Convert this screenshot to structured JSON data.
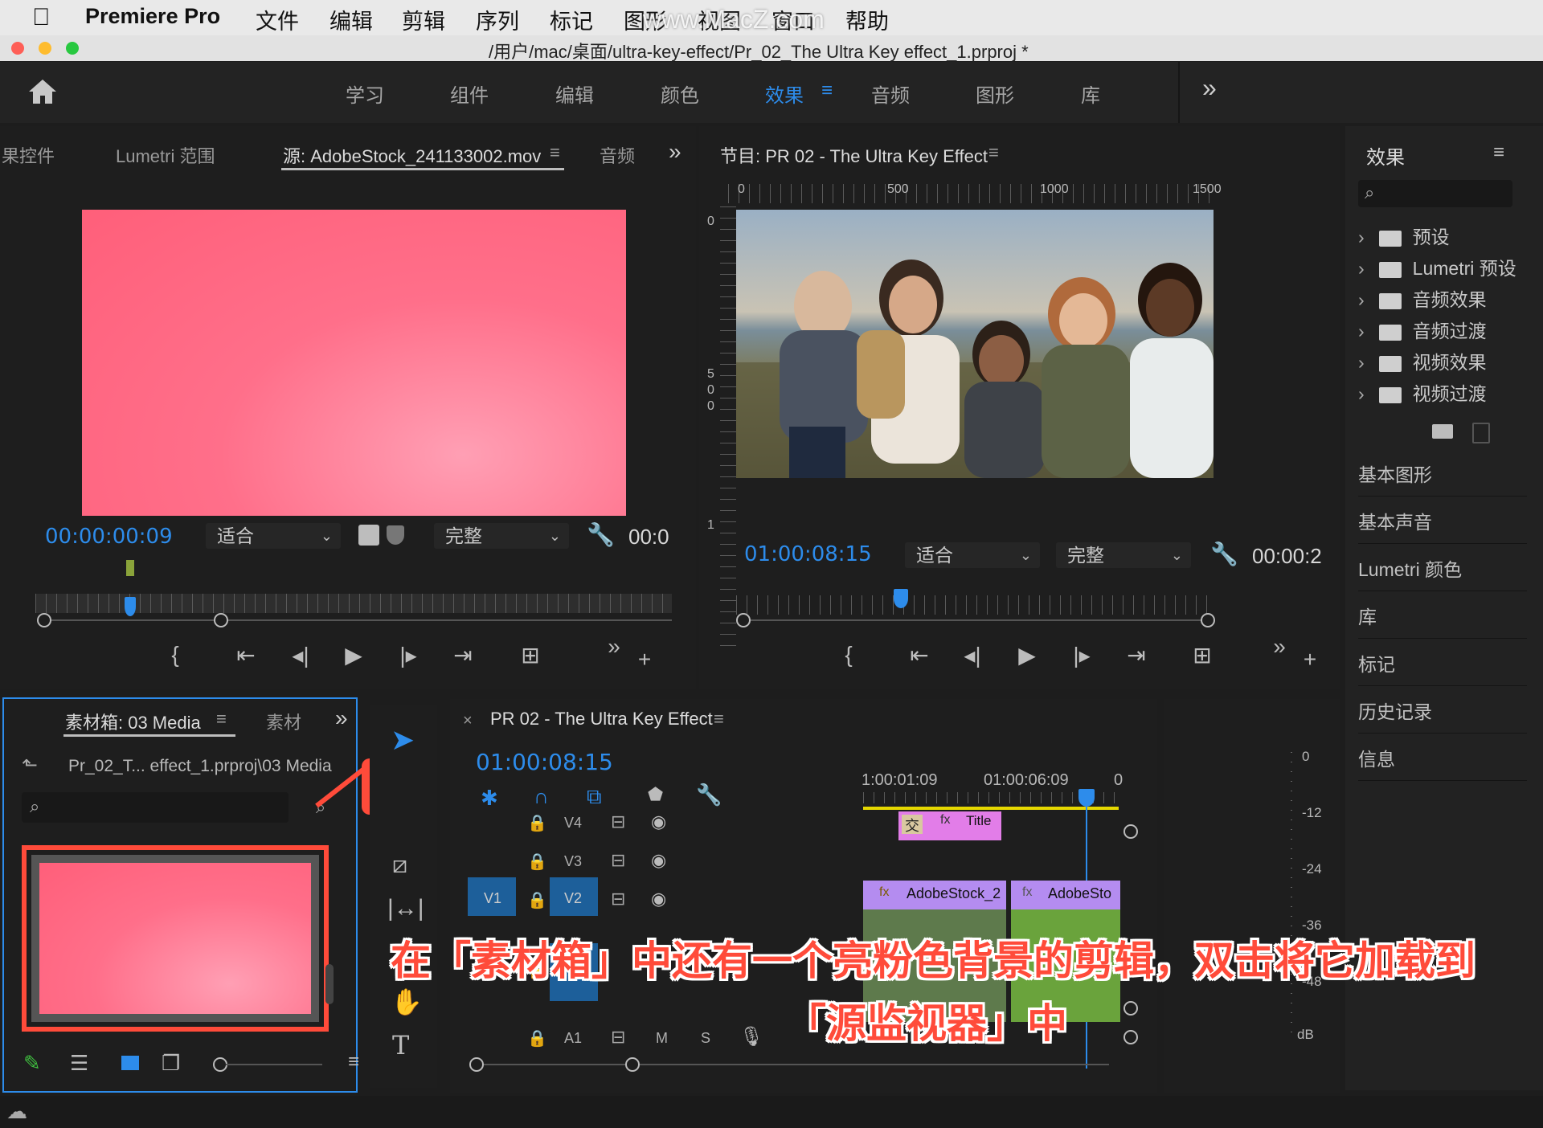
{
  "menubar": {
    "app": "Premiere Pro",
    "items": [
      "文件",
      "编辑",
      "剪辑",
      "序列",
      "标记",
      "图形",
      "视图",
      "窗口",
      "帮助"
    ],
    "watermark": "www.MacZ.com"
  },
  "titlebar": {
    "path": "/用户/mac/桌面/ultra-key-effect/Pr_02_The Ultra Key effect_1.prproj *"
  },
  "workspaces": {
    "tabs": [
      "学习",
      "组件",
      "编辑",
      "颜色",
      "效果",
      "音频",
      "图形",
      "库"
    ],
    "active": "效果",
    "menu_glyph": "≡",
    "overflow": "»"
  },
  "source_monitor": {
    "tabs": [
      "果控件",
      "Lumetri 范围",
      "源: AdobeStock_241133002.mov",
      "音频"
    ],
    "active_tab": "源: AdobeStock_241133002.mov",
    "timecode": "00:00:00:09",
    "fit": "适合",
    "quality": "完整",
    "end_timecode": "00:0",
    "playhead_fraction": 0.14
  },
  "program_monitor": {
    "title": "节目: PR 02 - The Ultra Key Effect",
    "ruler_labels": [
      "0",
      "500",
      "1000",
      "1500"
    ],
    "vruler_labels": [
      "0",
      "5",
      "0",
      "0",
      "1"
    ],
    "timecode": "01:00:08:15",
    "fit": "适合",
    "quality": "完整",
    "end_timecode": "00:00:2",
    "playhead_fraction": 0.33
  },
  "effects_panel": {
    "title": "效果",
    "search_placeholder": "",
    "items": [
      "预设",
      "Lumetri 预设",
      "音频效果",
      "音频过渡",
      "视频效果",
      "视频过渡"
    ]
  },
  "side_panels": [
    "基本图形",
    "基本声音",
    "Lumetri 颜色",
    "库",
    "标记",
    "历史记录",
    "信息"
  ],
  "project": {
    "tabs": [
      "素材箱: 03 Media",
      "素材"
    ],
    "path": "Pr_02_T... effect_1.prproj\\03 Media",
    "callout": "双击"
  },
  "timeline": {
    "title": "PR 02 - The Ultra Key Effect",
    "timecode": "01:00:08:15",
    "ruler_labels": [
      "1:00:01:09",
      "01:00:06:09",
      "0"
    ],
    "tracks": [
      "V4",
      "V3",
      "V2",
      "V1",
      "A1"
    ],
    "src_labels": [
      "V1"
    ],
    "audio_toggles": [
      "M",
      "S"
    ],
    "clips": [
      {
        "name": "Title",
        "track": "V4"
      },
      {
        "name": "AdobeStock_2",
        "track": "V2"
      },
      {
        "name": "AdobeSto",
        "track": "V2"
      }
    ],
    "transition_label": "交"
  },
  "audio_meter": {
    "labels": [
      "0",
      "-12",
      "-24",
      "-36",
      "-48",
      "dB"
    ]
  },
  "caption": {
    "line1": "在「素材箱」中还有一个亮粉色背景的剪辑，双击将它加载到",
    "line2": "「源监视器」中"
  },
  "colors": {
    "accent_blue": "#2d8ceb",
    "caption_red": "#ff4b3a",
    "highlight_red": "#ff4b3a",
    "pink_clip": "#ff6f8a"
  }
}
